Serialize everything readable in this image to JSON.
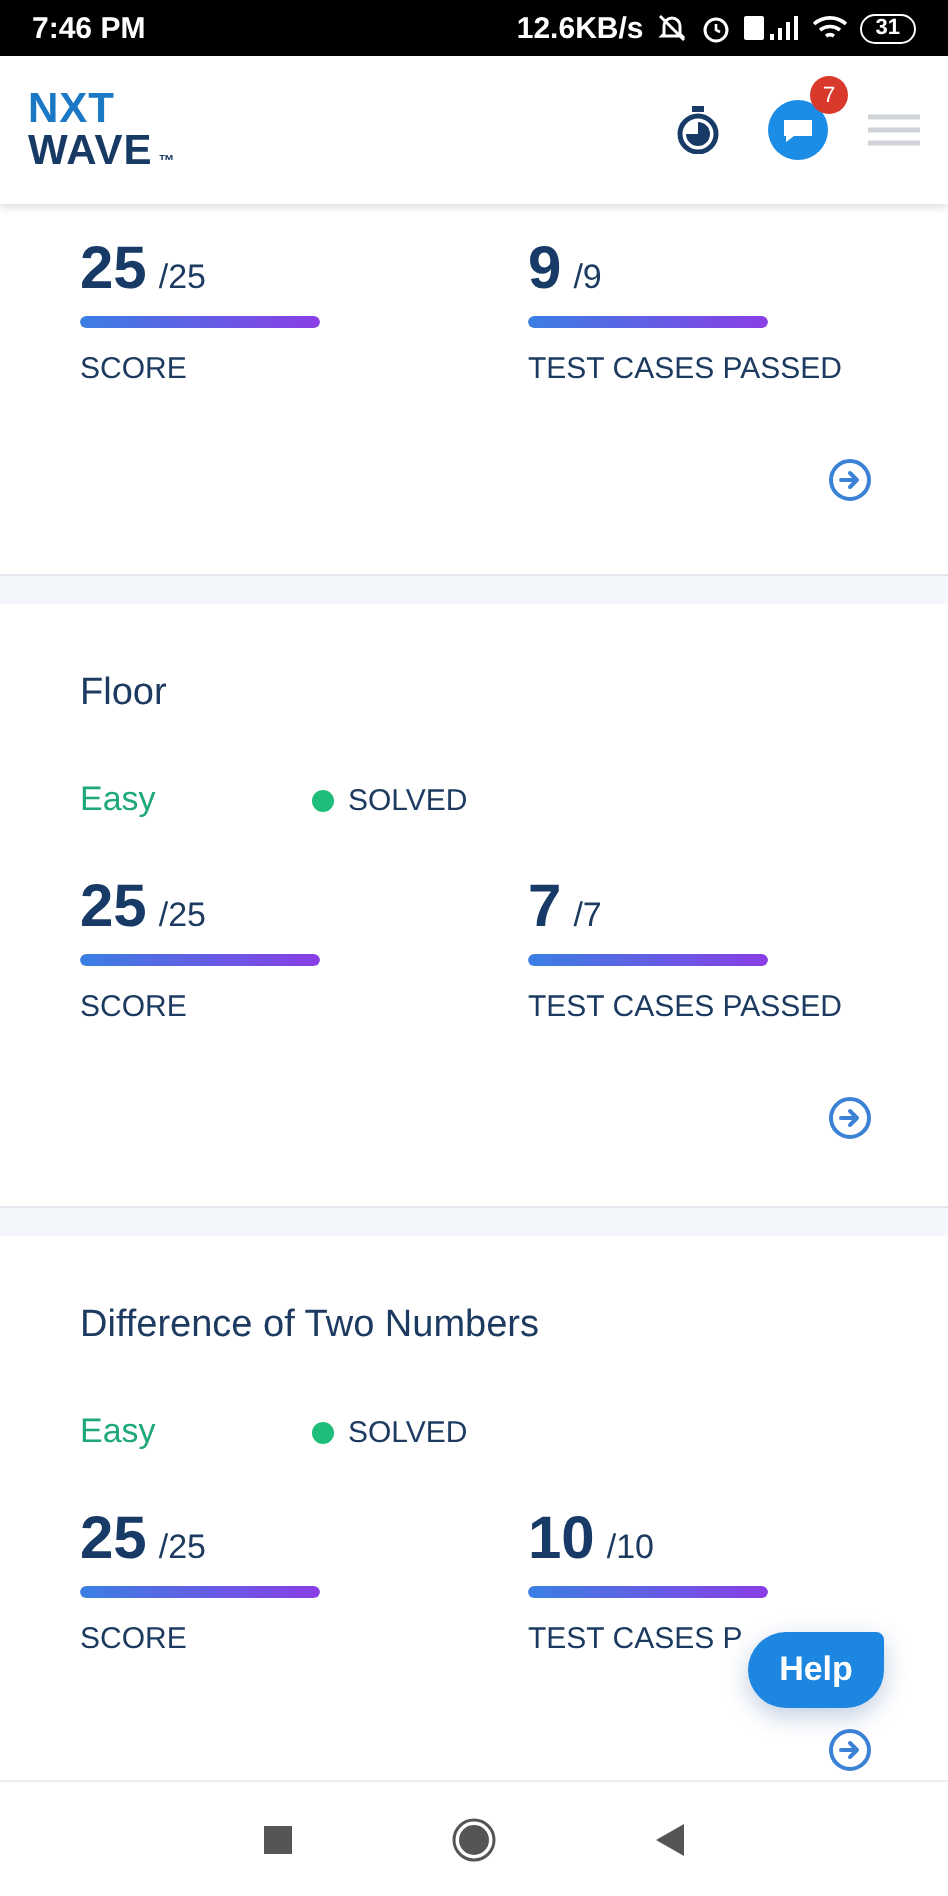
{
  "status_bar": {
    "time": "7:46 PM",
    "speed": "12.6KB/s",
    "battery": "31"
  },
  "header": {
    "logo": {
      "top": "NXT",
      "bottom": "WAVE",
      "mark": "™"
    },
    "badge": "7"
  },
  "problems": [
    {
      "stats": [
        {
          "value": "25",
          "max": "/25",
          "level": 1,
          "label": "SCORE"
        },
        {
          "value": "9",
          "max": "/9",
          "level": 1,
          "label": "TEST CASES PASSED"
        }
      ]
    },
    {
      "title": "Floor",
      "difficulty": "Easy",
      "status": {
        "label": "SOLVED",
        "color": "#1fbd7a"
      },
      "stats": [
        {
          "value": "25",
          "max": "/25",
          "level": 1,
          "label": "SCORE"
        },
        {
          "value": "7",
          "max": "/7",
          "level": 1,
          "label": "TEST CASES PASSED"
        }
      ]
    },
    {
      "title": "Difference of Two Numbers",
      "difficulty": "Easy",
      "status": {
        "label": "SOLVED",
        "color": "#1fbd7a"
      },
      "stats": [
        {
          "value": "25",
          "max": "/25",
          "level": 1,
          "label": "SCORE"
        },
        {
          "value": "10",
          "max": "/10",
          "level": 1,
          "label": "TEST CASES P"
        }
      ]
    }
  ],
  "help_button": "Help"
}
